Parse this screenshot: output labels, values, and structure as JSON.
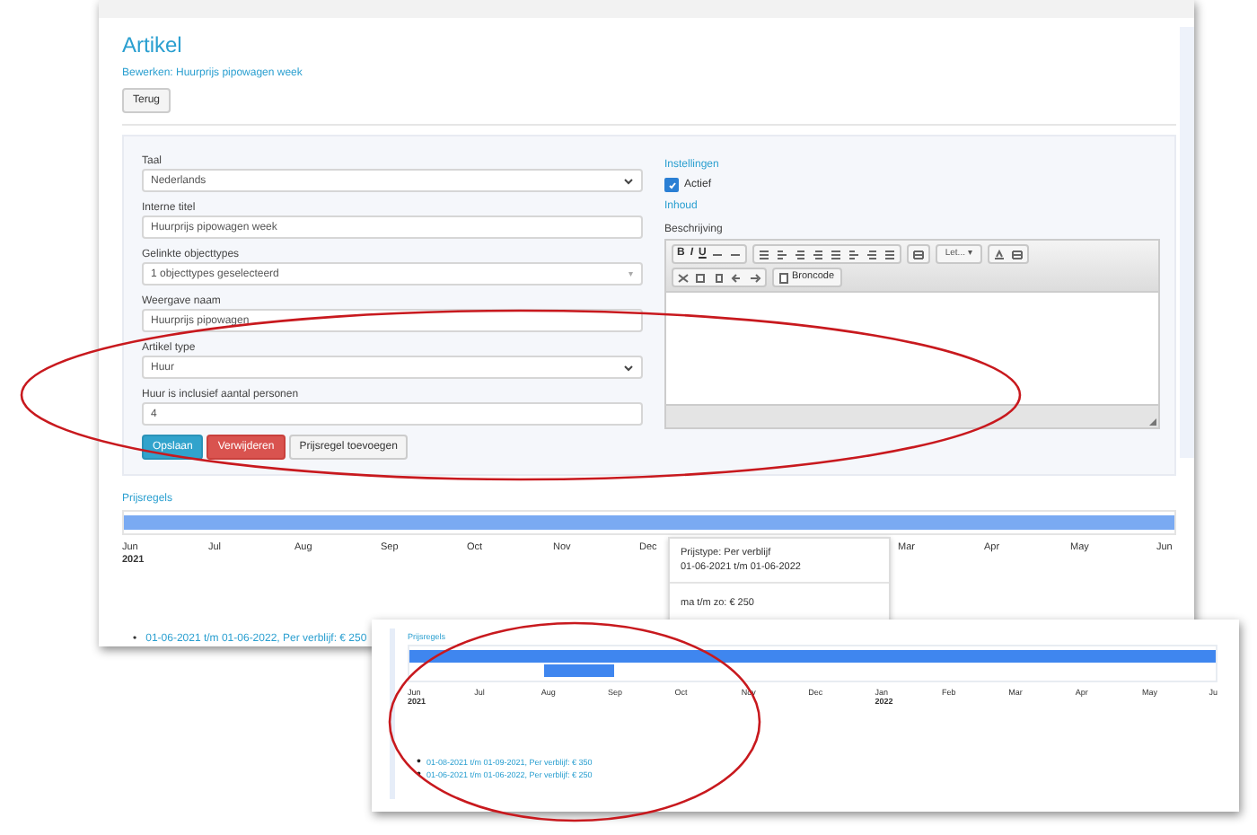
{
  "main": {
    "title": "Artikel",
    "subtitle": "Bewerken: Huurprijs pipowagen week",
    "back_button": "Terug",
    "fields": [
      {
        "kind": "select",
        "label": "Taal",
        "value": "Nederlands"
      },
      {
        "kind": "input",
        "label": "Interne titel",
        "value": "Huurprijs pipowagen week"
      },
      {
        "kind": "multiselect",
        "label": "Gelinkte objecttypes",
        "value": "1 objecttypes geselecteerd",
        "caret": "▾"
      },
      {
        "kind": "input",
        "label": "Weergave naam",
        "value": "Huurprijs pipowagen"
      },
      {
        "kind": "select",
        "label": "Artikel type",
        "value": "Huur"
      },
      {
        "kind": "input",
        "label": "Huur is inclusief aantal personen",
        "value": "4"
      }
    ],
    "buttons": [
      {
        "kind": "primary",
        "label": "Opslaan"
      },
      {
        "kind": "danger",
        "label": "Verwijderen"
      },
      {
        "kind": "default",
        "label": "Prijsregel toevoegen"
      }
    ],
    "settings": {
      "heading": "Instellingen",
      "active": {
        "label": "Actief",
        "checked": true
      }
    },
    "content": {
      "heading": "Inhoud",
      "label": "Beschrijving",
      "toolbar_text": [
        "B",
        "I",
        "U"
      ],
      "font_dropdown": "Let...",
      "font_dropdown_caret": "▾",
      "source_button": "Broncode"
    },
    "price_rules": {
      "heading": "Prijsregels",
      "timeline": {
        "rows": [
          {
            "kind": "full"
          }
        ],
        "months_before": [
          {
            "label": "Jun",
            "year": "2021"
          },
          {
            "label": "Jul"
          },
          {
            "label": "Aug"
          },
          {
            "label": "Sep"
          },
          {
            "label": "Oct"
          },
          {
            "label": "Nov"
          },
          {
            "label": "Dec"
          }
        ],
        "months_after": [
          {
            "label": "Mar"
          },
          {
            "label": "Apr"
          },
          {
            "label": "May"
          },
          {
            "label": "Jun"
          }
        ]
      },
      "tooltip": {
        "type": "Prijstype: Per verblijf",
        "period": "01-06-2021 t/m 01-06-2022",
        "price": "ma t/m zo: € 250"
      },
      "bullet": "•",
      "items": [
        "01-06-2021 t/m 01-06-2022, Per verblijf: € 250"
      ]
    }
  },
  "inset": {
    "heading": "Prijsregels",
    "timeline": {
      "rows": [
        {
          "kind": "full"
        },
        {
          "kind": "partial"
        }
      ],
      "months": [
        {
          "label": "Jun",
          "year": "2021"
        },
        {
          "label": "Jul"
        },
        {
          "label": "Aug"
        },
        {
          "label": "Sep"
        },
        {
          "label": "Oct"
        },
        {
          "label": "Nov"
        },
        {
          "label": "Dec"
        },
        {
          "label": "Jan",
          "year": "2022"
        },
        {
          "label": "Feb"
        },
        {
          "label": "Mar"
        },
        {
          "label": "Apr"
        },
        {
          "label": "May"
        },
        {
          "label": "Ju"
        }
      ]
    },
    "bullet": "•",
    "items": [
      "01-08-2021 t/m 01-09-2021, Per verblijf: € 350",
      "01-06-2021 t/m 01-06-2022, Per verblijf: € 250"
    ]
  },
  "annotations": [
    {
      "kind": "ellipse"
    },
    {
      "kind": "ellipse"
    }
  ]
}
